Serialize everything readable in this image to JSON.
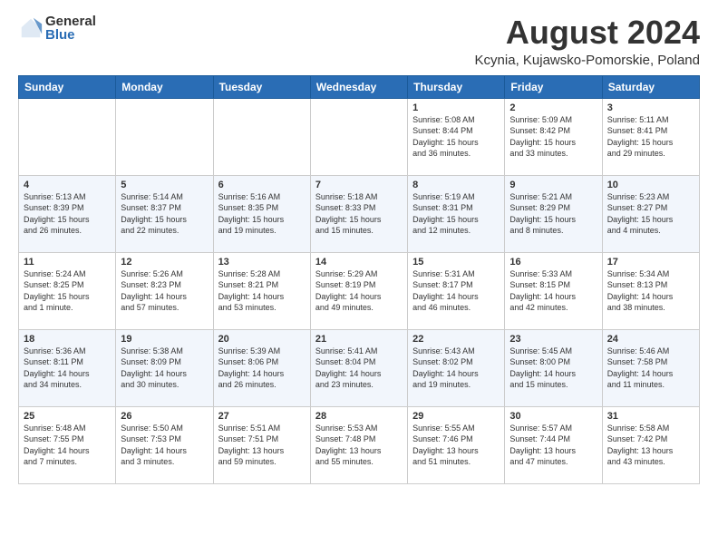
{
  "logo": {
    "general": "General",
    "blue": "Blue"
  },
  "title": {
    "month_year": "August 2024",
    "location": "Kcynia, Kujawsko-Pomorskie, Poland"
  },
  "headers": [
    "Sunday",
    "Monday",
    "Tuesday",
    "Wednesday",
    "Thursday",
    "Friday",
    "Saturday"
  ],
  "weeks": [
    [
      {
        "day": "",
        "info": ""
      },
      {
        "day": "",
        "info": ""
      },
      {
        "day": "",
        "info": ""
      },
      {
        "day": "",
        "info": ""
      },
      {
        "day": "1",
        "info": "Sunrise: 5:08 AM\nSunset: 8:44 PM\nDaylight: 15 hours\nand 36 minutes."
      },
      {
        "day": "2",
        "info": "Sunrise: 5:09 AM\nSunset: 8:42 PM\nDaylight: 15 hours\nand 33 minutes."
      },
      {
        "day": "3",
        "info": "Sunrise: 5:11 AM\nSunset: 8:41 PM\nDaylight: 15 hours\nand 29 minutes."
      }
    ],
    [
      {
        "day": "4",
        "info": "Sunrise: 5:13 AM\nSunset: 8:39 PM\nDaylight: 15 hours\nand 26 minutes."
      },
      {
        "day": "5",
        "info": "Sunrise: 5:14 AM\nSunset: 8:37 PM\nDaylight: 15 hours\nand 22 minutes."
      },
      {
        "day": "6",
        "info": "Sunrise: 5:16 AM\nSunset: 8:35 PM\nDaylight: 15 hours\nand 19 minutes."
      },
      {
        "day": "7",
        "info": "Sunrise: 5:18 AM\nSunset: 8:33 PM\nDaylight: 15 hours\nand 15 minutes."
      },
      {
        "day": "8",
        "info": "Sunrise: 5:19 AM\nSunset: 8:31 PM\nDaylight: 15 hours\nand 12 minutes."
      },
      {
        "day": "9",
        "info": "Sunrise: 5:21 AM\nSunset: 8:29 PM\nDaylight: 15 hours\nand 8 minutes."
      },
      {
        "day": "10",
        "info": "Sunrise: 5:23 AM\nSunset: 8:27 PM\nDaylight: 15 hours\nand 4 minutes."
      }
    ],
    [
      {
        "day": "11",
        "info": "Sunrise: 5:24 AM\nSunset: 8:25 PM\nDaylight: 15 hours\nand 1 minute."
      },
      {
        "day": "12",
        "info": "Sunrise: 5:26 AM\nSunset: 8:23 PM\nDaylight: 14 hours\nand 57 minutes."
      },
      {
        "day": "13",
        "info": "Sunrise: 5:28 AM\nSunset: 8:21 PM\nDaylight: 14 hours\nand 53 minutes."
      },
      {
        "day": "14",
        "info": "Sunrise: 5:29 AM\nSunset: 8:19 PM\nDaylight: 14 hours\nand 49 minutes."
      },
      {
        "day": "15",
        "info": "Sunrise: 5:31 AM\nSunset: 8:17 PM\nDaylight: 14 hours\nand 46 minutes."
      },
      {
        "day": "16",
        "info": "Sunrise: 5:33 AM\nSunset: 8:15 PM\nDaylight: 14 hours\nand 42 minutes."
      },
      {
        "day": "17",
        "info": "Sunrise: 5:34 AM\nSunset: 8:13 PM\nDaylight: 14 hours\nand 38 minutes."
      }
    ],
    [
      {
        "day": "18",
        "info": "Sunrise: 5:36 AM\nSunset: 8:11 PM\nDaylight: 14 hours\nand 34 minutes."
      },
      {
        "day": "19",
        "info": "Sunrise: 5:38 AM\nSunset: 8:09 PM\nDaylight: 14 hours\nand 30 minutes."
      },
      {
        "day": "20",
        "info": "Sunrise: 5:39 AM\nSunset: 8:06 PM\nDaylight: 14 hours\nand 26 minutes."
      },
      {
        "day": "21",
        "info": "Sunrise: 5:41 AM\nSunset: 8:04 PM\nDaylight: 14 hours\nand 23 minutes."
      },
      {
        "day": "22",
        "info": "Sunrise: 5:43 AM\nSunset: 8:02 PM\nDaylight: 14 hours\nand 19 minutes."
      },
      {
        "day": "23",
        "info": "Sunrise: 5:45 AM\nSunset: 8:00 PM\nDaylight: 14 hours\nand 15 minutes."
      },
      {
        "day": "24",
        "info": "Sunrise: 5:46 AM\nSunset: 7:58 PM\nDaylight: 14 hours\nand 11 minutes."
      }
    ],
    [
      {
        "day": "25",
        "info": "Sunrise: 5:48 AM\nSunset: 7:55 PM\nDaylight: 14 hours\nand 7 minutes."
      },
      {
        "day": "26",
        "info": "Sunrise: 5:50 AM\nSunset: 7:53 PM\nDaylight: 14 hours\nand 3 minutes."
      },
      {
        "day": "27",
        "info": "Sunrise: 5:51 AM\nSunset: 7:51 PM\nDaylight: 13 hours\nand 59 minutes."
      },
      {
        "day": "28",
        "info": "Sunrise: 5:53 AM\nSunset: 7:48 PM\nDaylight: 13 hours\nand 55 minutes."
      },
      {
        "day": "29",
        "info": "Sunrise: 5:55 AM\nSunset: 7:46 PM\nDaylight: 13 hours\nand 51 minutes."
      },
      {
        "day": "30",
        "info": "Sunrise: 5:57 AM\nSunset: 7:44 PM\nDaylight: 13 hours\nand 47 minutes."
      },
      {
        "day": "31",
        "info": "Sunrise: 5:58 AM\nSunset: 7:42 PM\nDaylight: 13 hours\nand 43 minutes."
      }
    ]
  ]
}
